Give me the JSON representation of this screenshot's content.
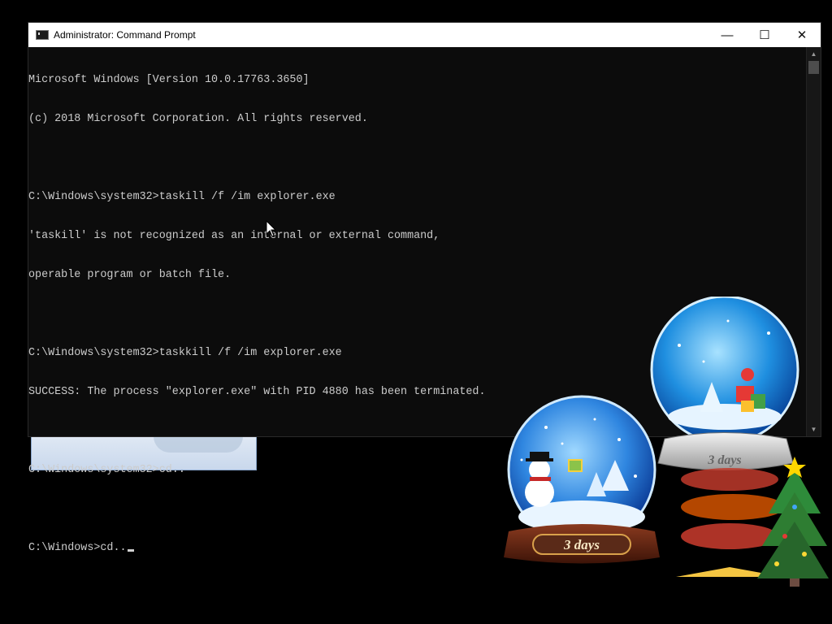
{
  "window": {
    "title": "Administrator: Command Prompt",
    "minimize_glyph": "—",
    "maximize_glyph": "☐",
    "close_glyph": "✕"
  },
  "terminal": {
    "lines": [
      "Microsoft Windows [Version 10.0.17763.3650]",
      "(c) 2018 Microsoft Corporation. All rights reserved.",
      "",
      "C:\\Windows\\system32>taskill /f /im explorer.exe",
      "'taskill' is not recognized as an internal or external command,",
      "operable program or batch file.",
      "",
      "C:\\Windows\\system32>taskkill /f /im explorer.exe",
      "SUCCESS: The process \"explorer.exe\" with PID 4880 has been terminated.",
      "",
      "C:\\Windows\\system32>cd..",
      "",
      "C:\\Windows>cd.."
    ]
  },
  "widgets": {
    "globe_left_label": "3 days",
    "globe_right_label": "3 days"
  },
  "icons": {
    "app": "command-prompt-icon",
    "cursor": "mouse-pointer-icon"
  }
}
